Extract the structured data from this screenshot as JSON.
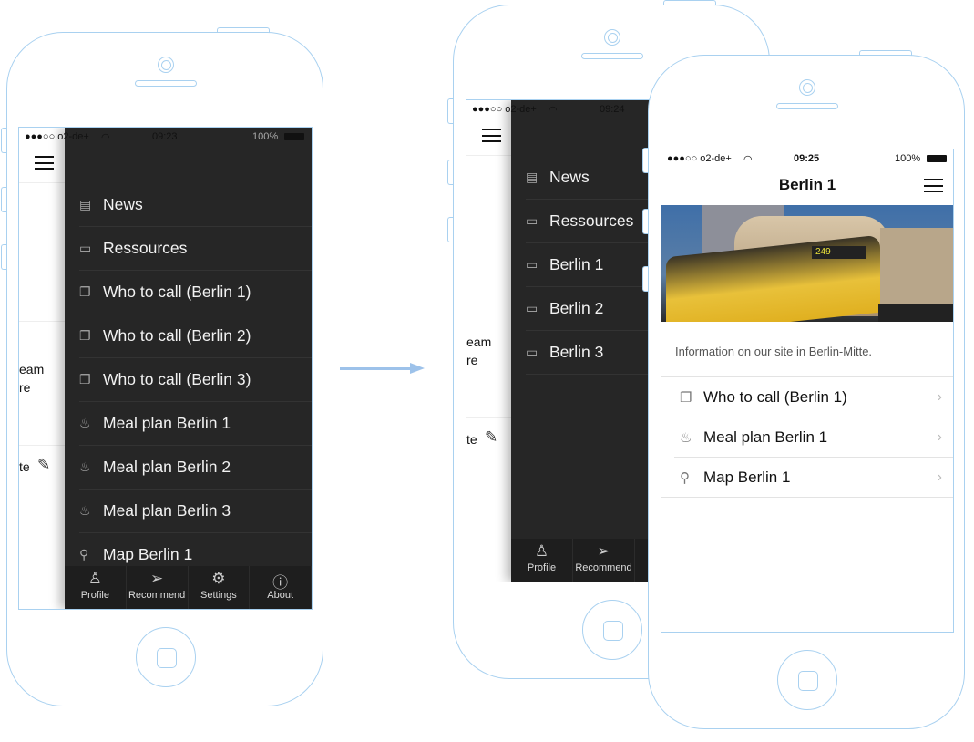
{
  "outline_color": "#a9d1f0",
  "drawer_color": "#262626",
  "phone1": {
    "status": {
      "carrier": "●●●○○ o2-de+",
      "wifi": "wifi-icon",
      "time": "09:23",
      "battery": "100%"
    },
    "strip_texts": [
      "eam",
      "re",
      "te"
    ],
    "menu": [
      {
        "icon": "news-icon",
        "glyph": "▤",
        "label": "News"
      },
      {
        "icon": "folder-icon",
        "glyph": "▭",
        "label": "Ressources"
      },
      {
        "icon": "document-icon",
        "glyph": "❐",
        "label": "Who to call (Berlin 1)"
      },
      {
        "icon": "document-icon",
        "glyph": "❐",
        "label": "Who to call (Berlin 2)"
      },
      {
        "icon": "document-icon",
        "glyph": "❐",
        "label": "Who to call (Berlin 3)"
      },
      {
        "icon": "meal-icon",
        "glyph": "♨",
        "label": "Meal plan Berlin 1"
      },
      {
        "icon": "meal-icon",
        "glyph": "♨",
        "label": "Meal plan Berlin 2"
      },
      {
        "icon": "meal-icon",
        "glyph": "♨",
        "label": "Meal plan Berlin 3"
      },
      {
        "icon": "map-pin-icon",
        "glyph": "⚲",
        "label": "Map Berlin 1"
      }
    ],
    "tabs": [
      {
        "icon": "profile-icon",
        "glyph": "♙",
        "label": "Profile"
      },
      {
        "icon": "send-icon",
        "glyph": "➢",
        "label": "Recommend"
      },
      {
        "icon": "gear-icon",
        "glyph": "⚙",
        "label": "Settings"
      },
      {
        "icon": "info-icon",
        "glyph": "ⓘ",
        "label": "About"
      }
    ]
  },
  "phone2": {
    "status": {
      "carrier": "●●●○○ o2-de+",
      "time": "09:24"
    },
    "strip_texts": [
      "eam",
      "re",
      "te"
    ],
    "menu": [
      {
        "icon": "news-icon",
        "glyph": "▤",
        "label": "News"
      },
      {
        "icon": "folder-icon",
        "glyph": "▭",
        "label": "Ressources"
      },
      {
        "icon": "folder-icon",
        "glyph": "▭",
        "label": "Berlin 1"
      },
      {
        "icon": "folder-icon",
        "glyph": "▭",
        "label": "Berlin 2"
      },
      {
        "icon": "folder-icon",
        "glyph": "▭",
        "label": "Berlin 3"
      }
    ],
    "tabs": [
      {
        "icon": "profile-icon",
        "glyph": "♙",
        "label": "Profile"
      },
      {
        "icon": "send-icon",
        "glyph": "➢",
        "label": "Recommend"
      }
    ]
  },
  "phone3": {
    "status": {
      "carrier": "●●●○○ o2-de+",
      "time": "09:25",
      "battery": "100%"
    },
    "title": "Berlin 1",
    "bus_sign": "249",
    "description": "Information on our site in Berlin-Mitte.",
    "rows": [
      {
        "icon": "document-icon",
        "glyph": "❐",
        "label": "Who to call (Berlin 1)"
      },
      {
        "icon": "meal-icon",
        "glyph": "♨",
        "label": "Meal plan Berlin 1"
      },
      {
        "icon": "map-pin-icon",
        "glyph": "⚲",
        "label": "Map Berlin 1"
      }
    ]
  }
}
